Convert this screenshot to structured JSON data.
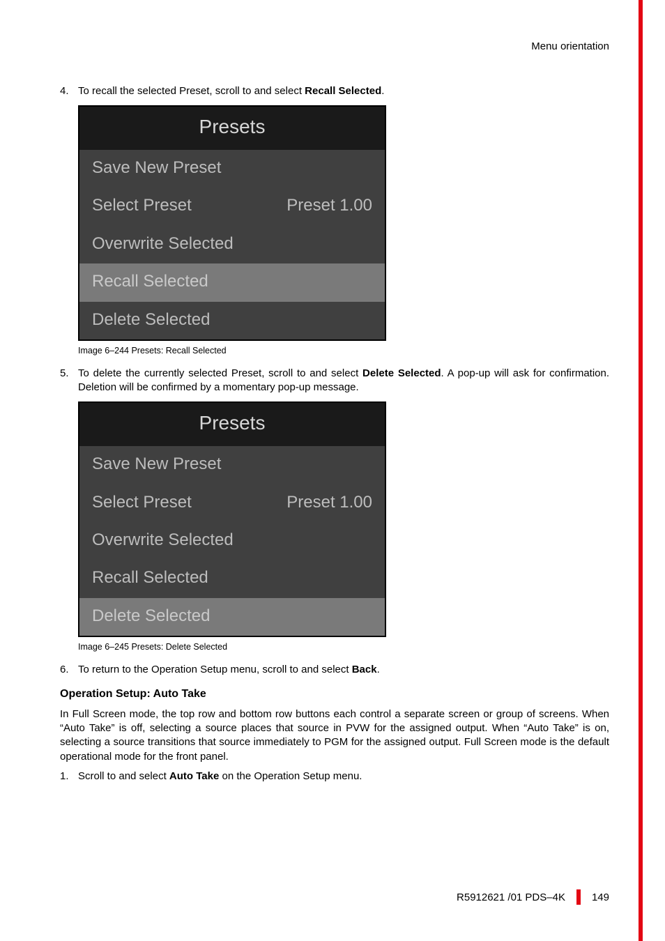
{
  "header": {
    "section": "Menu orientation"
  },
  "steps": {
    "s4": {
      "num": "4.",
      "text_before": "To recall the selected Preset, scroll to and select ",
      "bold": "Recall Selected",
      "text_after": "."
    },
    "s5": {
      "num": "5.",
      "text_before": "To delete the currently selected Preset, scroll to and select ",
      "bold": "Delete Selected",
      "text_after": ". A pop-up will ask for confirmation. Deletion will be confirmed by a momentary pop-up message."
    },
    "s6": {
      "num": "6.",
      "text_before": "To return to the Operation Setup menu, scroll to and select ",
      "bold": "Back",
      "text_after": "."
    },
    "s1b": {
      "num": "1.",
      "text_before": "Scroll to and select ",
      "bold": "Auto Take",
      "text_after": " on the Operation Setup menu."
    }
  },
  "screenshot1": {
    "title": "Presets",
    "rows": [
      {
        "label": "Save New Preset",
        "value": "",
        "selected": false
      },
      {
        "label": "Select Preset",
        "value": "Preset 1.00",
        "selected": false
      },
      {
        "label": "Overwrite Selected",
        "value": "",
        "selected": false
      },
      {
        "label": "Recall Selected",
        "value": "",
        "selected": true
      },
      {
        "label": "Delete Selected",
        "value": "",
        "selected": false
      }
    ],
    "caption": "Image 6–244  Presets: Recall Selected"
  },
  "screenshot2": {
    "title": "Presets",
    "rows": [
      {
        "label": "Save New Preset",
        "value": "",
        "selected": false
      },
      {
        "label": "Select Preset",
        "value": "Preset 1.00",
        "selected": false
      },
      {
        "label": "Overwrite Selected",
        "value": "",
        "selected": false
      },
      {
        "label": "Recall Selected",
        "value": "",
        "selected": false
      },
      {
        "label": "Delete Selected",
        "value": "",
        "selected": true
      }
    ],
    "caption": "Image 6–245  Presets: Delete Selected"
  },
  "section2": {
    "heading": "Operation Setup: Auto Take",
    "para": "In Full Screen mode, the top row and bottom row buttons each control a separate screen or group of screens. When “Auto Take” is off, selecting a source places that source in PVW for the assigned output. When “Auto Take” is on, selecting a source transitions that source immediately to PGM for the assigned output. Full Screen mode is the default operational mode for the front panel."
  },
  "footer": {
    "doc": "R5912621 /01 PDS–4K",
    "page": "149"
  }
}
